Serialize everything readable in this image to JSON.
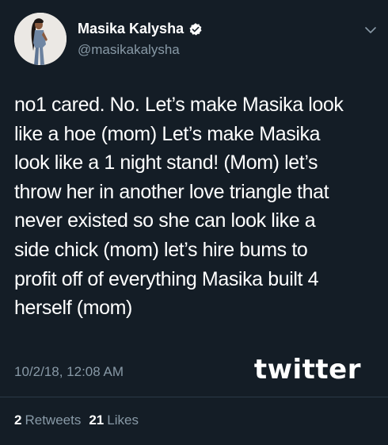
{
  "author": {
    "display_name": "Masika Kalysha",
    "handle": "@masikakalysha",
    "verified": true
  },
  "tweet": {
    "lines": [
      "no1 cared. No. Let’s make Masika look",
      "like a hoe (mom) Let’s make Masika",
      "look like a 1 night stand! (Mom) let’s",
      "throw her in another love triangle that",
      "never existed so she can look like a",
      "side chick (mom) let’s hire bums to",
      "profit off of everything Masika built 4",
      "herself (mom)"
    ],
    "timestamp": "10/2/18, 12:08 AM"
  },
  "watermark": "twitter",
  "stats": {
    "retweets_count": "2",
    "retweets_label": "Retweets",
    "likes_count": "21",
    "likes_label": "Likes"
  },
  "colors": {
    "background": "#141d26",
    "secondary_text": "#8899a6",
    "divider": "#2b3947"
  },
  "icons": [
    "verified-badge-icon",
    "chevron-down-icon"
  ]
}
